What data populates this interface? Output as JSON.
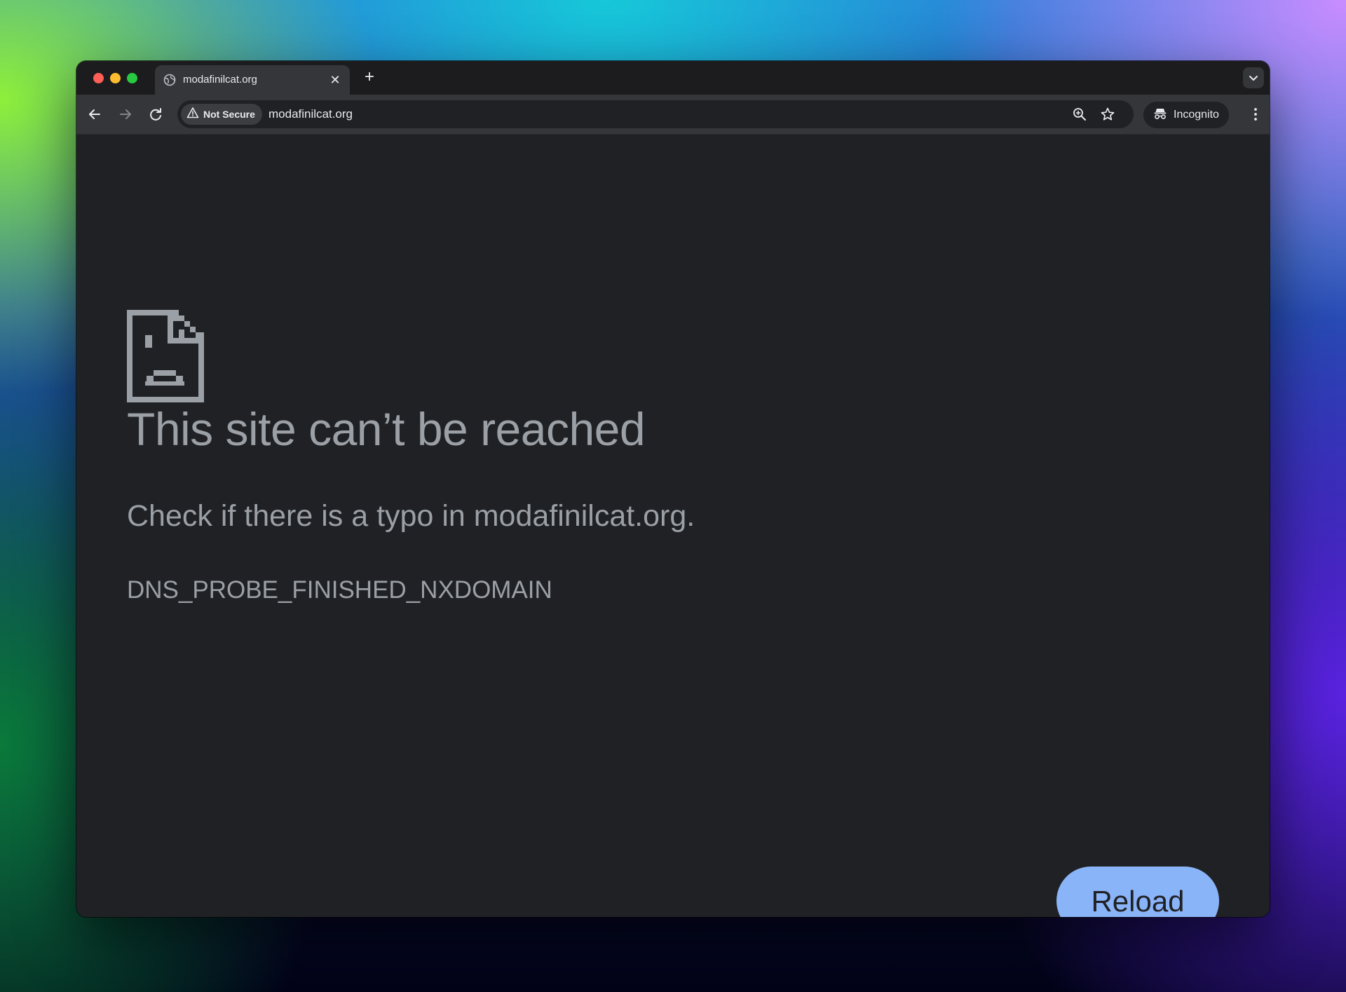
{
  "tab": {
    "title": "modafinilcat.org",
    "close_glyph": "✕",
    "favicon": "globe-icon"
  },
  "tabstrip": {
    "new_tab_glyph": "+",
    "tab_search_icon": "chevron-down-icon"
  },
  "toolbar": {
    "back_icon": "arrow-left-icon",
    "forward_icon": "arrow-right-icon",
    "reload_icon": "reload-icon",
    "security_label": "Not Secure",
    "security_icon": "warning-triangle-icon",
    "url": "modafinilcat.org",
    "zoom_icon": "zoom-icon",
    "bookmark_icon": "star-icon",
    "incognito_label": "Incognito",
    "incognito_icon": "incognito-icon",
    "menu_icon": "kebab-menu-icon"
  },
  "error_page": {
    "icon": "sad-document-icon",
    "title": "This site can’t be reached",
    "suggestion": "Check if there is a typo in modafinilcat.org.",
    "error_code": "DNS_PROBE_FINISHED_NXDOMAIN",
    "reload_label": "Reload"
  },
  "colors": {
    "window_bg": "#202124",
    "toolbar_bg": "#35363a",
    "text_muted": "#9aa0a6",
    "button_accent": "#8ab4f8"
  }
}
